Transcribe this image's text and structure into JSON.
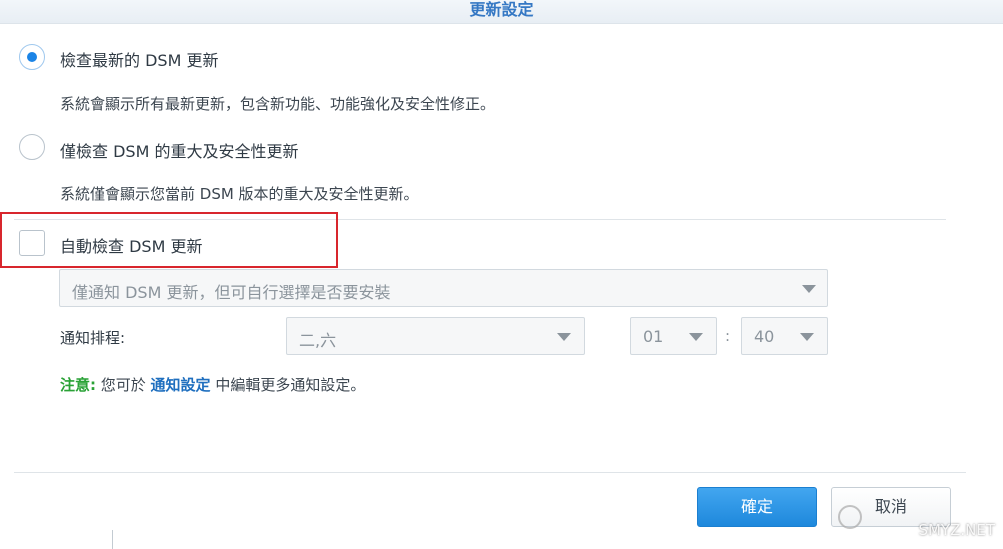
{
  "dialog": {
    "title": "更新設定"
  },
  "options": {
    "latest": {
      "label": "檢查最新的 DSM 更新",
      "desc": "系統會顯示所有最新更新，包含新功能、功能強化及安全性修正。",
      "checked": true
    },
    "security": {
      "label": "僅檢查 DSM 的重大及安全性更新",
      "desc": "系統僅會顯示您當前 DSM 版本的重大及安全性更新。",
      "checked": false
    }
  },
  "auto_check": {
    "label": "自動檢查 DSM 更新",
    "checked": false
  },
  "mode_select": {
    "value": "僅通知 DSM 更新，但可自行選擇是否要安裝"
  },
  "schedule": {
    "label": "通知排程:",
    "days": "二,六",
    "hour": "01",
    "separator": ":",
    "minute": "40"
  },
  "note": {
    "prefix": "注意:",
    "text_before": " 您可於 ",
    "link": "通知設定",
    "text_after": " 中編輯更多通知設定。"
  },
  "buttons": {
    "ok": "確定",
    "cancel": "取消"
  },
  "watermark": {
    "text": "SMYZ.NET"
  }
}
